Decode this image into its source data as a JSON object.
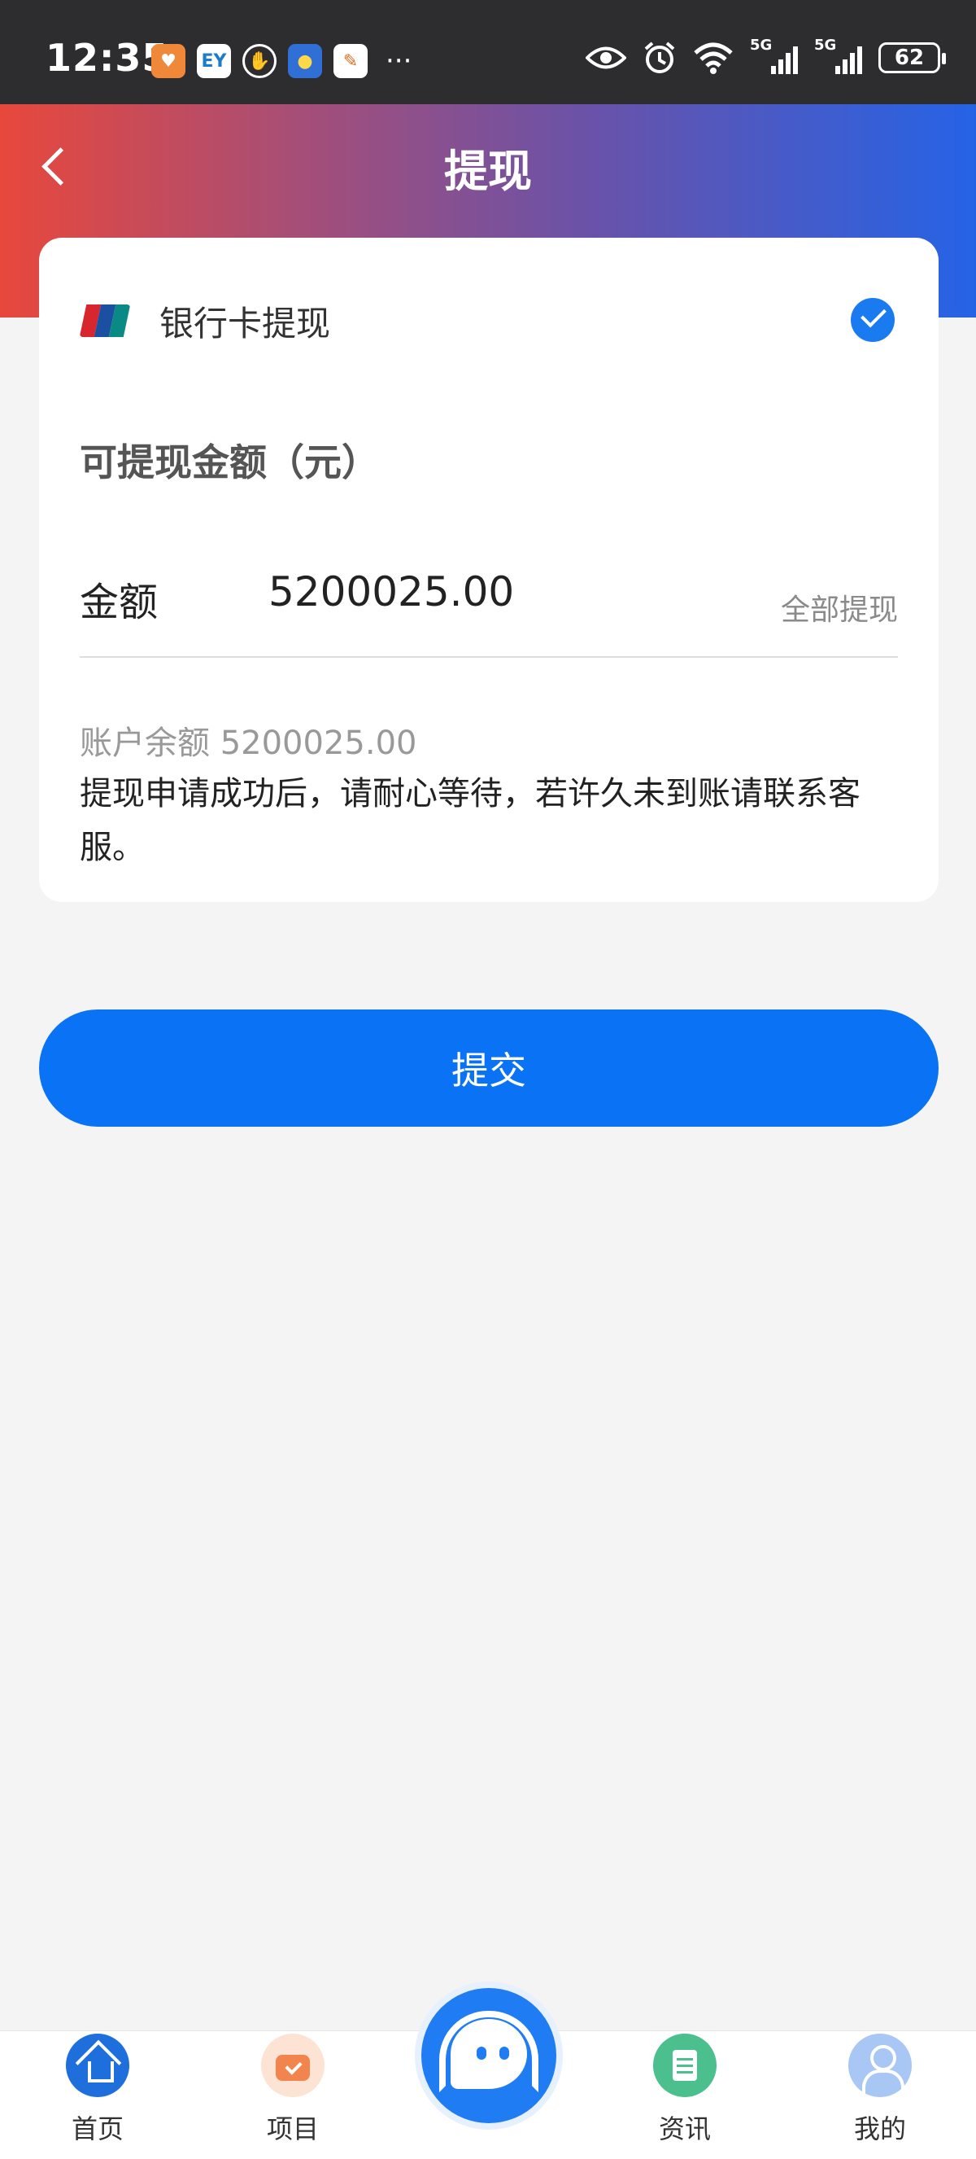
{
  "status_bar": {
    "time": "12:35",
    "notification_icons": [
      "heart-app-icon",
      "ey-app-icon",
      "hand-app-icon",
      "weather-app-icon",
      "paper-app-icon"
    ],
    "more": "···",
    "signal_1_label": "5G",
    "signal_2_label": "5G",
    "battery": "62"
  },
  "header": {
    "title": "提现",
    "gradient": [
      "#e8483c",
      "#a74e76",
      "#6a52a8",
      "#2563e6"
    ]
  },
  "withdraw": {
    "method_label": "银行卡提现",
    "method_selected": true,
    "amount_title": "可提现金额（元）",
    "amount_label": "金额",
    "amount_value": "5200025.00",
    "withdraw_all": "全部提现",
    "balance": "账户余额 5200025.00",
    "notice": "提现申请成功后，请耐心等待，若许久未到账请联系客服。"
  },
  "submit_label": "提交",
  "nav": {
    "items": [
      {
        "label": "首页",
        "icon": "home-icon"
      },
      {
        "label": "项目",
        "icon": "project-icon"
      },
      {
        "label": "资讯",
        "icon": "news-icon"
      },
      {
        "label": "我的",
        "icon": "user-icon"
      }
    ],
    "center_icon": "customer-service-icon"
  },
  "colors": {
    "accent": "#0a72f5",
    "check": "#1a7af0",
    "background": "#f4f4f5"
  }
}
